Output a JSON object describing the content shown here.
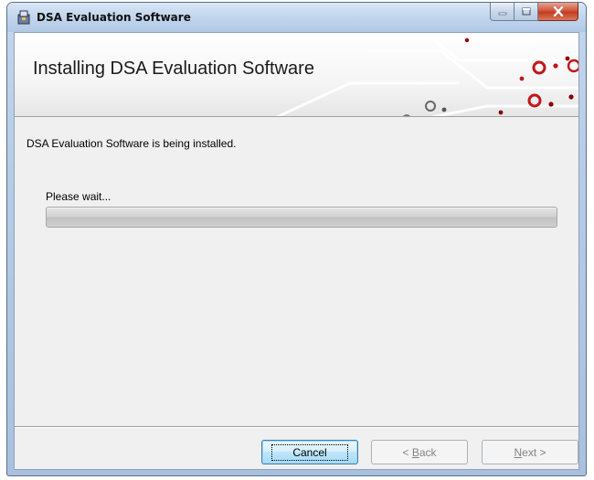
{
  "window": {
    "title": "DSA Evaluation Software"
  },
  "banner": {
    "title": "Installing DSA Evaluation Software"
  },
  "main": {
    "status_text": "DSA Evaluation Software is being installed.",
    "wait_text": "Please wait...",
    "progress_fraction": 0
  },
  "buttons": {
    "cancel": "Cancel",
    "back_prefix": "< ",
    "back_mnemonic": "B",
    "back_rest": "ack",
    "next_mnemonic": "N",
    "next_rest": "ext >"
  },
  "icons": {
    "app": "installer-icon",
    "minimize": "minimize-icon",
    "maximize": "maximize-icon",
    "close": "close-icon"
  },
  "colors": {
    "banner_dot_dark": "#8b0000",
    "banner_dot_red": "#c0171a",
    "banner_ring": "#555555",
    "close_button": "#c23c20"
  }
}
